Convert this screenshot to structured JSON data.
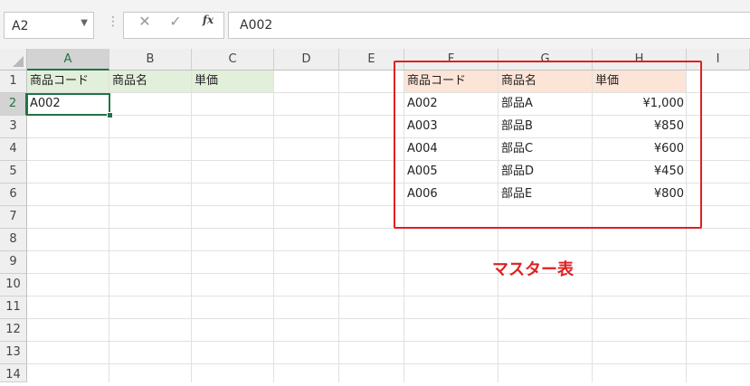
{
  "formula_bar": {
    "name_box": "A2",
    "cancel_icon": "✕",
    "enter_icon": "✓",
    "fx_label": "fx",
    "content": "A002"
  },
  "columns": [
    "A",
    "B",
    "C",
    "D",
    "E",
    "F",
    "G",
    "H",
    "I"
  ],
  "rows": [
    "1",
    "2",
    "3",
    "4",
    "5",
    "6",
    "7",
    "8",
    "9",
    "10",
    "11",
    "12",
    "13",
    "14"
  ],
  "selected_cell": "A2",
  "sheet": {
    "input_header": [
      "商品コード",
      "商品名",
      "単価"
    ],
    "input_row": [
      "A002",
      "",
      ""
    ],
    "master_header": [
      "商品コード",
      "商品名",
      "単価"
    ],
    "master_rows": [
      [
        "A002",
        "部品A",
        "¥1,000"
      ],
      [
        "A003",
        "部品B",
        "¥850"
      ],
      [
        "A004",
        "部品C",
        "¥600"
      ],
      [
        "A005",
        "部品D",
        "¥450"
      ],
      [
        "A006",
        "部品E",
        "¥800"
      ]
    ]
  },
  "annotation": {
    "label": "マスター表",
    "color": "#e02020"
  },
  "colors": {
    "selection_green": "#217346",
    "header_green_fill": "#e2efda",
    "header_orange_fill": "#fce4d6"
  }
}
